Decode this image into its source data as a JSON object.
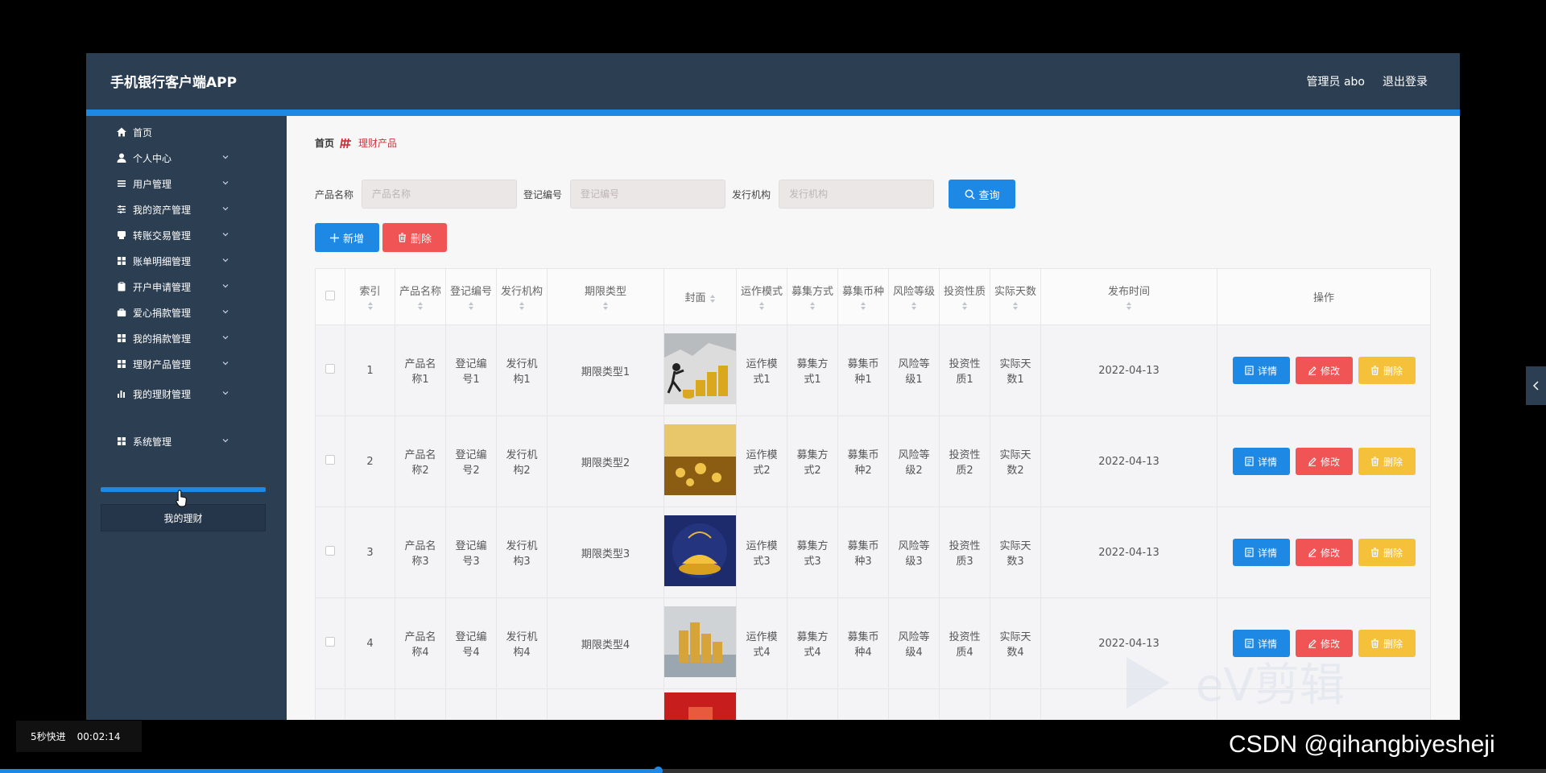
{
  "app": {
    "title": "手机银行客户端APP",
    "user": "管理员 abo",
    "logout": "退出登录"
  },
  "sidebar": {
    "items": [
      {
        "label": "首页",
        "icon": "home-icon",
        "has_sub": false
      },
      {
        "label": "个人中心",
        "icon": "user-icon",
        "has_sub": true
      },
      {
        "label": "用户管理",
        "icon": "list-icon",
        "has_sub": true
      },
      {
        "label": "我的资产管理",
        "icon": "sliders-icon",
        "has_sub": true
      },
      {
        "label": "转账交易管理",
        "icon": "printer-icon",
        "has_sub": true
      },
      {
        "label": "账单明细管理",
        "icon": "grid-icon",
        "has_sub": true
      },
      {
        "label": "开户申请管理",
        "icon": "clipboard-icon",
        "has_sub": true
      },
      {
        "label": "爱心捐款管理",
        "icon": "briefcase-icon",
        "has_sub": true
      },
      {
        "label": "我的捐款管理",
        "icon": "grid-icon",
        "has_sub": true
      },
      {
        "label": "理财产品管理",
        "icon": "grid-icon",
        "has_sub": true
      },
      {
        "label": "我的理财管理",
        "icon": "bar-chart-icon",
        "has_sub": true
      },
      {
        "label": "系统管理",
        "icon": "grid-icon",
        "has_sub": true
      }
    ],
    "submenu_label": "我的理财"
  },
  "breadcrumb": {
    "home": "首页",
    "current": "理财产品"
  },
  "search": {
    "fields": [
      {
        "label": "产品名称",
        "placeholder": "产品名称"
      },
      {
        "label": "登记编号",
        "placeholder": "登记编号"
      },
      {
        "label": "发行机构",
        "placeholder": "发行机构"
      }
    ],
    "query_label": "查询"
  },
  "toolbar": {
    "add_label": "新增",
    "delete_label": "删除"
  },
  "table": {
    "headers": [
      "索引",
      "产品名称",
      "登记编号",
      "发行机构",
      "期限类型",
      "封面",
      "运作模式",
      "募集方式",
      "募集币种",
      "风险等级",
      "投资性质",
      "实际天数",
      "发布时间",
      "操作"
    ],
    "rows": [
      {
        "index": "1",
        "name": "产品名称1",
        "reg": "登记编号1",
        "org": "发行机构1",
        "term": "期限类型1",
        "mode": "运作模式1",
        "raise": "募集方式1",
        "currency": "募集币种1",
        "risk": "风险等级1",
        "nature": "投资性质1",
        "days": "实际天数1",
        "date": "2022-04-13"
      },
      {
        "index": "2",
        "name": "产品名称2",
        "reg": "登记编号2",
        "org": "发行机构2",
        "term": "期限类型2",
        "mode": "运作模式2",
        "raise": "募集方式2",
        "currency": "募集币种2",
        "risk": "风险等级2",
        "nature": "投资性质2",
        "days": "实际天数2",
        "date": "2022-04-13"
      },
      {
        "index": "3",
        "name": "产品名称3",
        "reg": "登记编号3",
        "org": "发行机构3",
        "term": "期限类型3",
        "mode": "运作模式3",
        "raise": "募集方式3",
        "currency": "募集币种3",
        "risk": "风险等级3",
        "nature": "投资性质3",
        "days": "实际天数3",
        "date": "2022-04-13"
      },
      {
        "index": "4",
        "name": "产品名称4",
        "reg": "登记编号4",
        "org": "发行机构4",
        "term": "期限类型4",
        "mode": "运作模式4",
        "raise": "募集方式4",
        "currency": "募集币种4",
        "risk": "风险等级4",
        "nature": "投资性质4",
        "days": "实际天数4",
        "date": "2022-04-13"
      }
    ],
    "actions": {
      "detail": "详情",
      "edit": "修改",
      "delete": "删除"
    }
  },
  "player": {
    "skip_label": "5秒快进",
    "time": "00:02:14",
    "progress_fraction": 0.426
  },
  "watermark": {
    "text": "CSDN @qihangbiyesheji",
    "logo": "eV剪辑"
  },
  "colors": {
    "primary": "#1e88e5",
    "danger": "#f05454",
    "warning": "#f5c13a",
    "nav_bg": "#2c3e52",
    "breadcrumb_current": "#d0343b"
  }
}
